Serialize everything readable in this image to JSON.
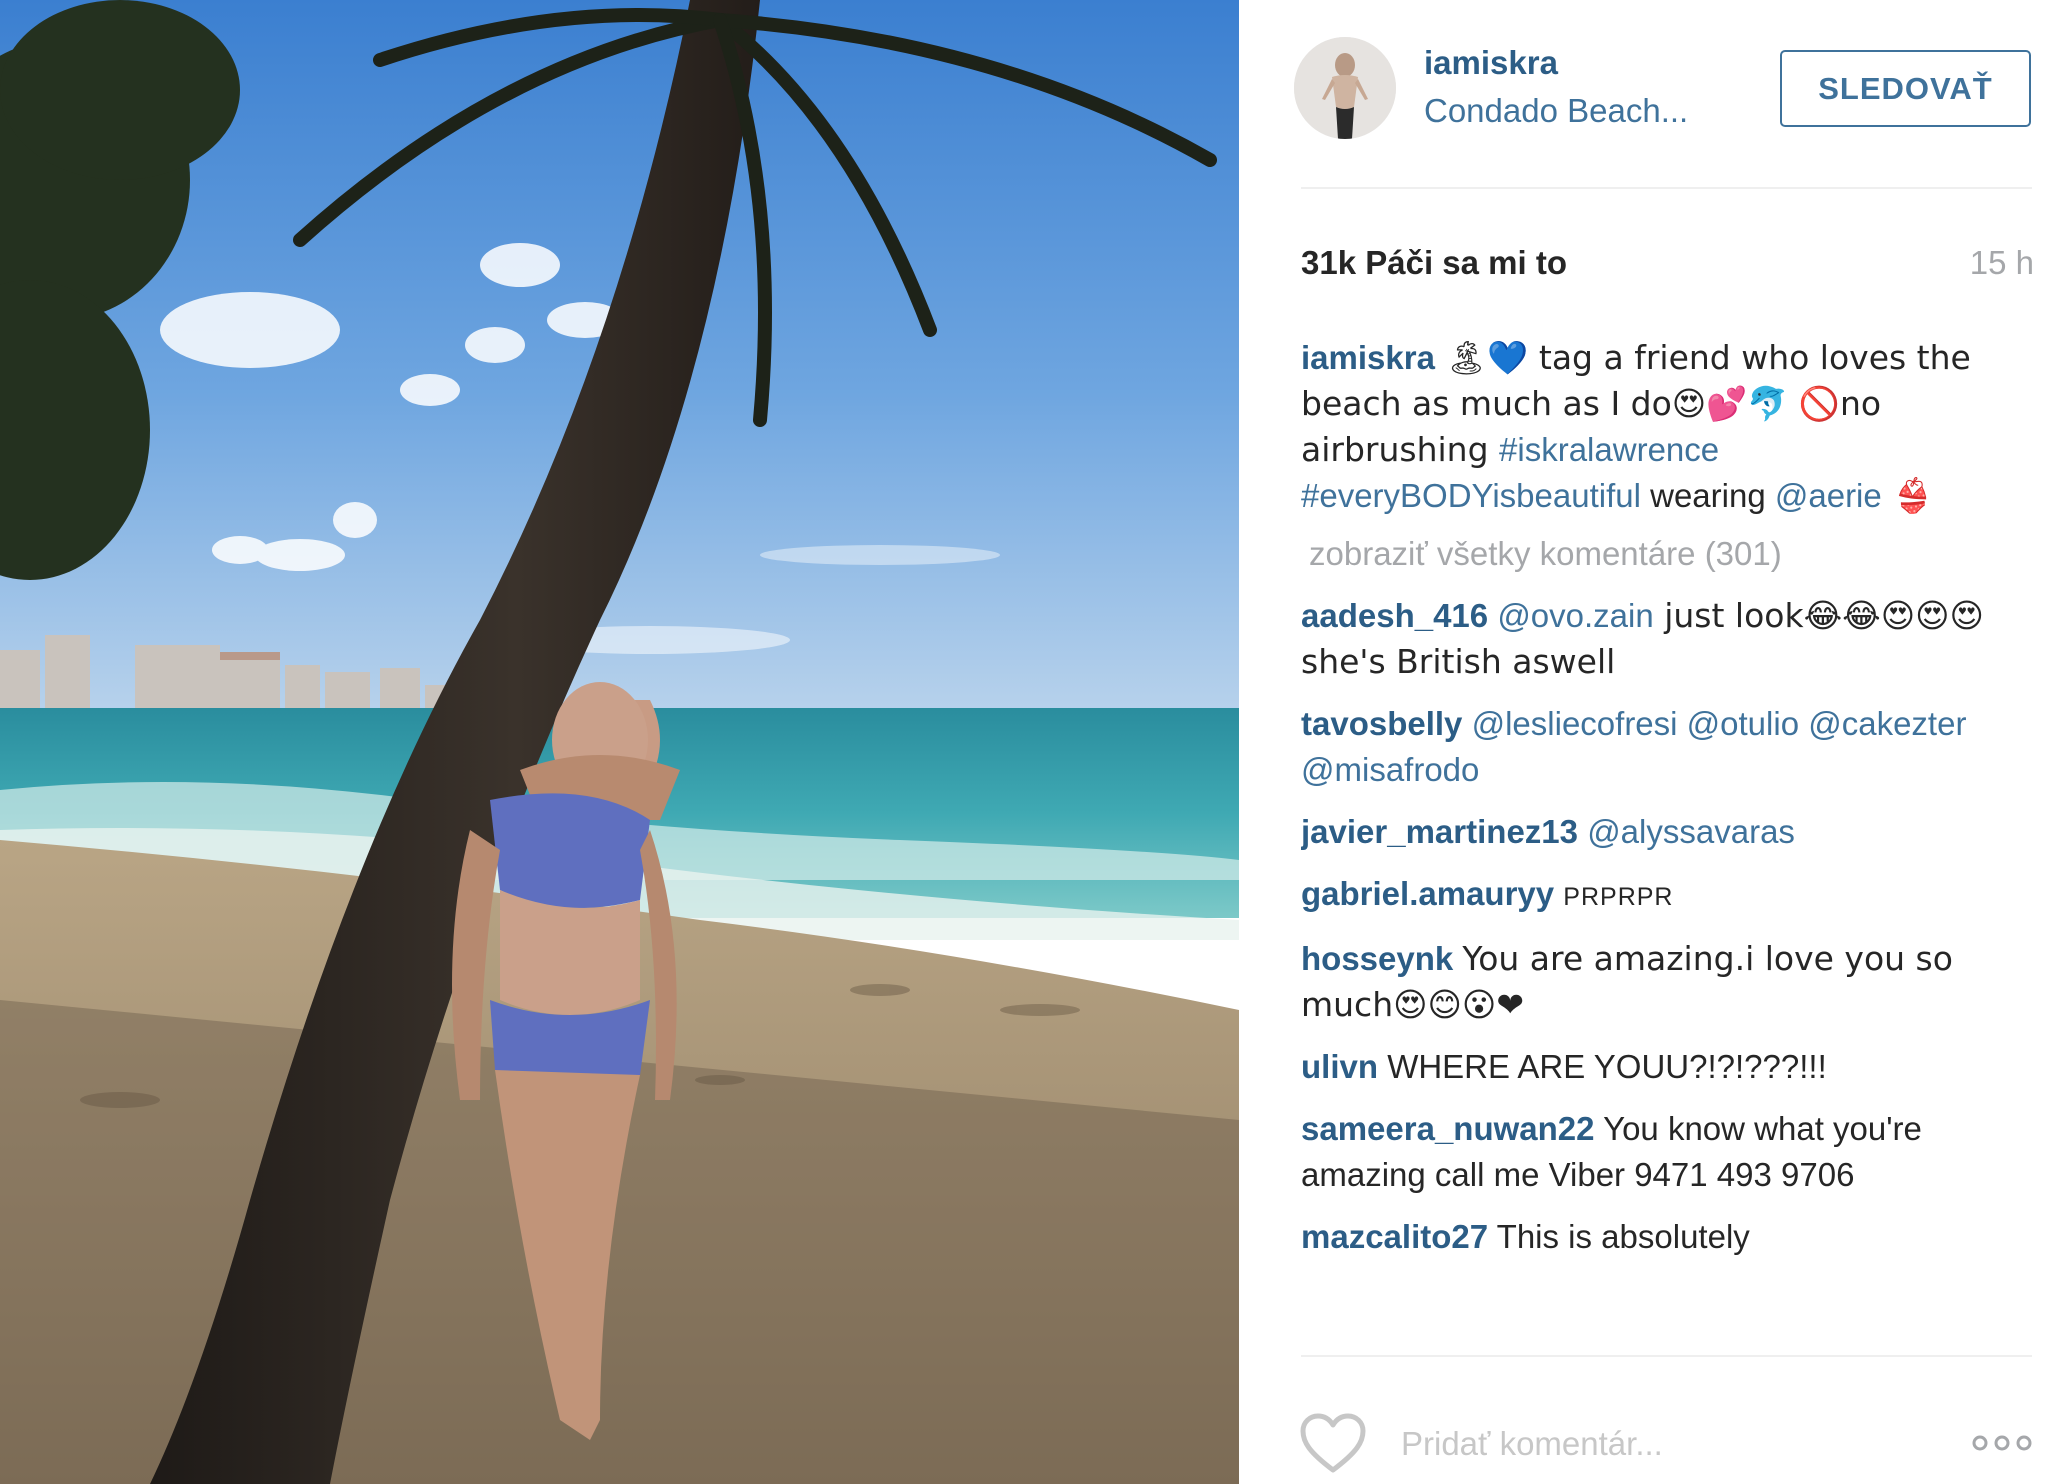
{
  "post": {
    "username": "iamiskra",
    "location": "Condado Beach...",
    "follow_label": "SLEDOVAŤ",
    "likes": "31k Páči sa mi to",
    "time": "15 h"
  },
  "caption": {
    "user": "iamiskra",
    "text_1": " 🏝💙 tag a friend who loves the beach as much as I do😍💕🐬 🚫no airbrushing ",
    "hashtag_1": "#iskralawrence",
    "hashtag_2": "#everyBODYisbeautiful",
    "text_2": " wearing ",
    "mention": "@aerie",
    "text_3": " 👙"
  },
  "view_all": "zobraziť všetky komentáre (301)",
  "comments": [
    {
      "user": "aadesh_416",
      "tag": "@ovo.zain",
      "text": " just look😂😂😍😍😍 she's British aswell"
    },
    {
      "user": "tavosbelly",
      "tag": "@lesliecofresi @otulio @cakezter @misafrodo",
      "text": ""
    },
    {
      "user": "javier_martinez13",
      "tag": "@alyssavaras",
      "text": ""
    },
    {
      "user": "gabriel.amauryy",
      "tag": "",
      "text": "PRPRPR"
    },
    {
      "user": "hosseynk",
      "tag": "",
      "text": "You are amazing.i love you so much😍😊😮❤"
    },
    {
      "user": "ulivn",
      "tag": "",
      "text": "WHERE ARE YOUU?!?!???!!!"
    },
    {
      "user": "sameera_nuwan22",
      "tag": "",
      "text": "You know what you're amazing call me Viber 9471 493 9706"
    },
    {
      "user": "mazcalito27",
      "tag": "",
      "text": "This is absolutely"
    }
  ],
  "footer": {
    "comment_placeholder": "Pridať komentár...",
    "heart_icon": "heart-outline-icon",
    "more_icon": "more-options-icon"
  },
  "colors": {
    "link": "#3f729b",
    "username": "#2c5d86",
    "muted": "#a5a7aa"
  }
}
